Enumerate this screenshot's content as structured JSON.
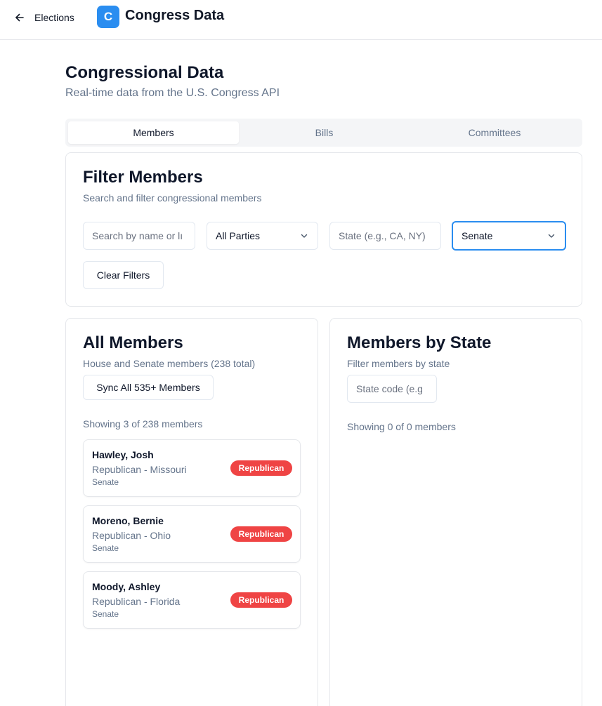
{
  "header": {
    "back_label": "Elections",
    "logo_letter": "C",
    "app_title": "Congress Data"
  },
  "page": {
    "title": "Congressional Data",
    "subtitle": "Real-time data from the U.S. Congress API"
  },
  "tabs": [
    {
      "label": "Members",
      "active": true
    },
    {
      "label": "Bills",
      "active": false
    },
    {
      "label": "Committees",
      "active": false
    }
  ],
  "filter": {
    "title": "Filter Members",
    "description": "Search and filter congressional members",
    "search_placeholder": "Search by name or lı",
    "party_value": "All Parties",
    "state_placeholder": "State (e.g., CA, NY)",
    "chamber_value": "Senate",
    "clear_label": "Clear Filters"
  },
  "all_members": {
    "title": "All Members",
    "description": "House and Senate members (238 total)",
    "sync_label": "Sync All 535+ Members",
    "showing": "Showing 3 of 238 members",
    "members": [
      {
        "name": "Hawley, Josh",
        "party_state": "Republican - Missouri",
        "chamber": "Senate",
        "badge": "Republican"
      },
      {
        "name": "Moreno, Bernie",
        "party_state": "Republican - Ohio",
        "chamber": "Senate",
        "badge": "Republican"
      },
      {
        "name": "Moody, Ashley",
        "party_state": "Republican - Florida",
        "chamber": "Senate",
        "badge": "Republican"
      }
    ]
  },
  "by_state": {
    "title": "Members by State",
    "description": "Filter members by state",
    "state_placeholder": "State code (e.g",
    "showing": "Showing 0 of 0 members"
  },
  "colors": {
    "accent": "#2a8df0",
    "republican": "#ef4444"
  }
}
